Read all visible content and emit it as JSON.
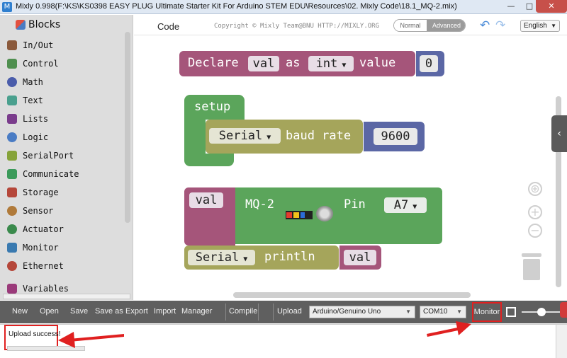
{
  "window": {
    "title": "Mixly 0.998(F:\\KS\\KS0398 EASY PLUG Ultimate Starter Kit For Arduino STEM EDU\\Resources\\02. Mixly Code\\18.1_MQ-2.mix)",
    "app_icon": "M",
    "minimize": "—",
    "maximize": "□",
    "close": "✕"
  },
  "sidebar": {
    "title": "Blocks",
    "items": [
      {
        "label": "In/Out",
        "icon": "arrows-icon",
        "color": "#8b5a3c"
      },
      {
        "label": "Control",
        "icon": "gamepad-icon",
        "color": "#4f8f4f"
      },
      {
        "label": "Math",
        "icon": "math-icon",
        "color": "#4b5dab"
      },
      {
        "label": "Text",
        "icon": "text-icon",
        "color": "#4aa08e"
      },
      {
        "label": "Lists",
        "icon": "lists-icon",
        "color": "#7a3c8c"
      },
      {
        "label": "Logic",
        "icon": "bulb-icon",
        "color": "#4a7cc4"
      },
      {
        "label": "SerialPort",
        "icon": "pen-icon",
        "color": "#86a33a"
      },
      {
        "label": "Communicate",
        "icon": "antenna-icon",
        "color": "#3b9a5a"
      },
      {
        "label": "Storage",
        "icon": "storage-icon",
        "color": "#b5473a"
      },
      {
        "label": "Sensor",
        "icon": "sensor-icon",
        "color": "#b07a3a"
      },
      {
        "label": "Actuator",
        "icon": "actuator-icon",
        "color": "#3a8a4c"
      },
      {
        "label": "Monitor",
        "icon": "monitor-icon",
        "color": "#3a7ab0"
      },
      {
        "label": "Ethernet",
        "icon": "globe-icon",
        "color": "#b5473a"
      },
      {
        "label": "Variables",
        "icon": "variables-icon",
        "color": "#9a3a7a"
      }
    ]
  },
  "header": {
    "tab": "Code",
    "copyright": "Copyright © Mixly Team@BNU HTTP://MIXLY.ORG",
    "mode_normal": "Normal",
    "mode_advanced": "Advanced",
    "undo": "↶",
    "redo": "↷",
    "language": "English"
  },
  "blocks": {
    "declare": {
      "kw": "Declare",
      "var": "val",
      "as": "as",
      "type": "int",
      "value_kw": "value",
      "value": "0"
    },
    "setup": {
      "label": "setup",
      "serial": "Serial",
      "baud_kw": "baud rate",
      "baud": "9600"
    },
    "assign": {
      "var": "val",
      "sensor": "MQ-2",
      "pin_kw": "Pin",
      "pin": "A7"
    },
    "println": {
      "serial": "Serial",
      "kw": "println",
      "var": "val"
    }
  },
  "colors": {
    "declare_block": "#a5557a",
    "variable_block": "#a5557a",
    "setup_block": "#5ba55b",
    "serial_block": "#a5a55b",
    "sensor_block": "#5ba55b",
    "number_block": "#5b67a5",
    "toolbar": "#5f5f5f",
    "highlight": "#e02020"
  },
  "toolbar": {
    "new": "New",
    "open": "Open",
    "save": "Save",
    "save_as": "Save as",
    "export": "Export",
    "import": "Import",
    "manager": "Manager",
    "compile": "Compile",
    "upload": "Upload",
    "board": "Arduino/Genuino Uno",
    "port": "COM10",
    "monitor": "Monitor"
  },
  "output": {
    "message": "Upload success!"
  }
}
